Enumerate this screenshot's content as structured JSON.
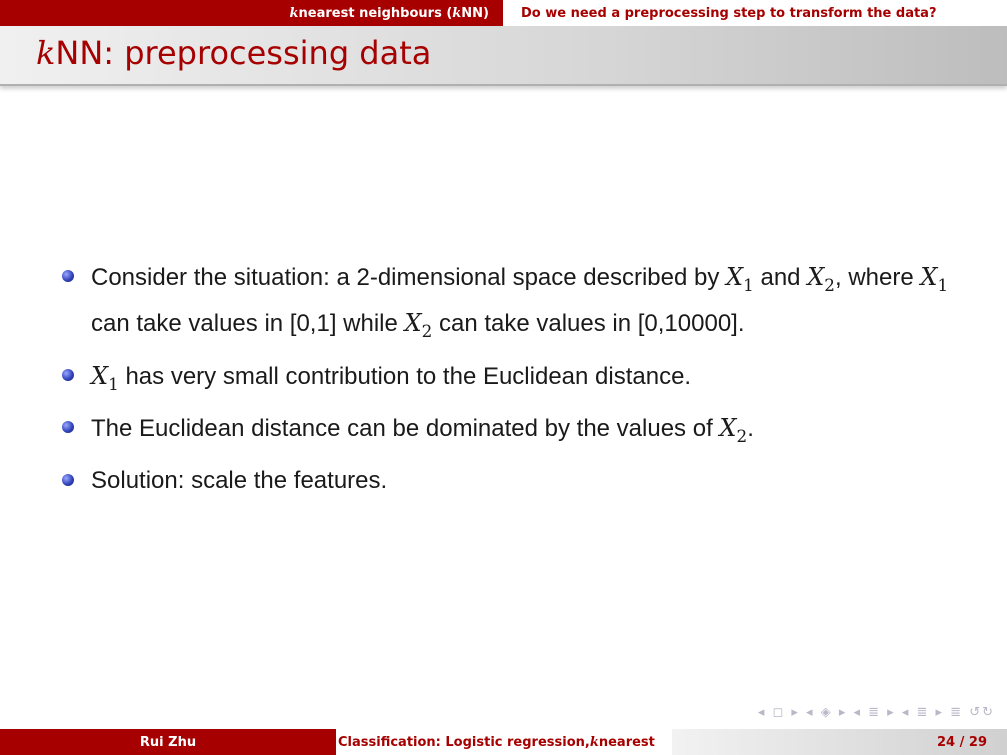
{
  "header": {
    "section_var": "k",
    "section_text": " nearest neighbours (",
    "section_var2": "k",
    "section_text2": "NN)",
    "subsection": "Do we need a preprocessing step to transform the data?"
  },
  "slide": {
    "title_var": "k",
    "title_text": "NN: preprocessing data"
  },
  "bullets": [
    {
      "p1": "Consider the situation: a 2-dimensional space described by ",
      "v1": "X",
      "s1": "1",
      "p2": " and ",
      "v2": "X",
      "s2": "2",
      "p3": ", where ",
      "v3": "X",
      "s3": "1",
      "p4": " can take values in [0,1] while ",
      "v4": "X",
      "s4": "2",
      "p5": " can take values in [0,10000]."
    },
    {
      "v1": "X",
      "s1": "1",
      "p1": " has very small contribution to the Euclidean distance."
    },
    {
      "p1": "The Euclidean distance can be dominated by the values of ",
      "v1": "X",
      "s1": "2",
      "p2": "."
    },
    {
      "p1": "Solution: scale the features."
    }
  ],
  "nav": {
    "icons": "◂ ◻ ▸ ◂ ◈ ▸ ◂ ≣ ▸ ◂ ≣ ▸  ≣  ↺↻"
  },
  "footer": {
    "author": "Rui Zhu",
    "title_text": "Classification: Logistic regression, ",
    "title_var": "k",
    "title_text2": " nearest",
    "page": "24 / 29"
  }
}
